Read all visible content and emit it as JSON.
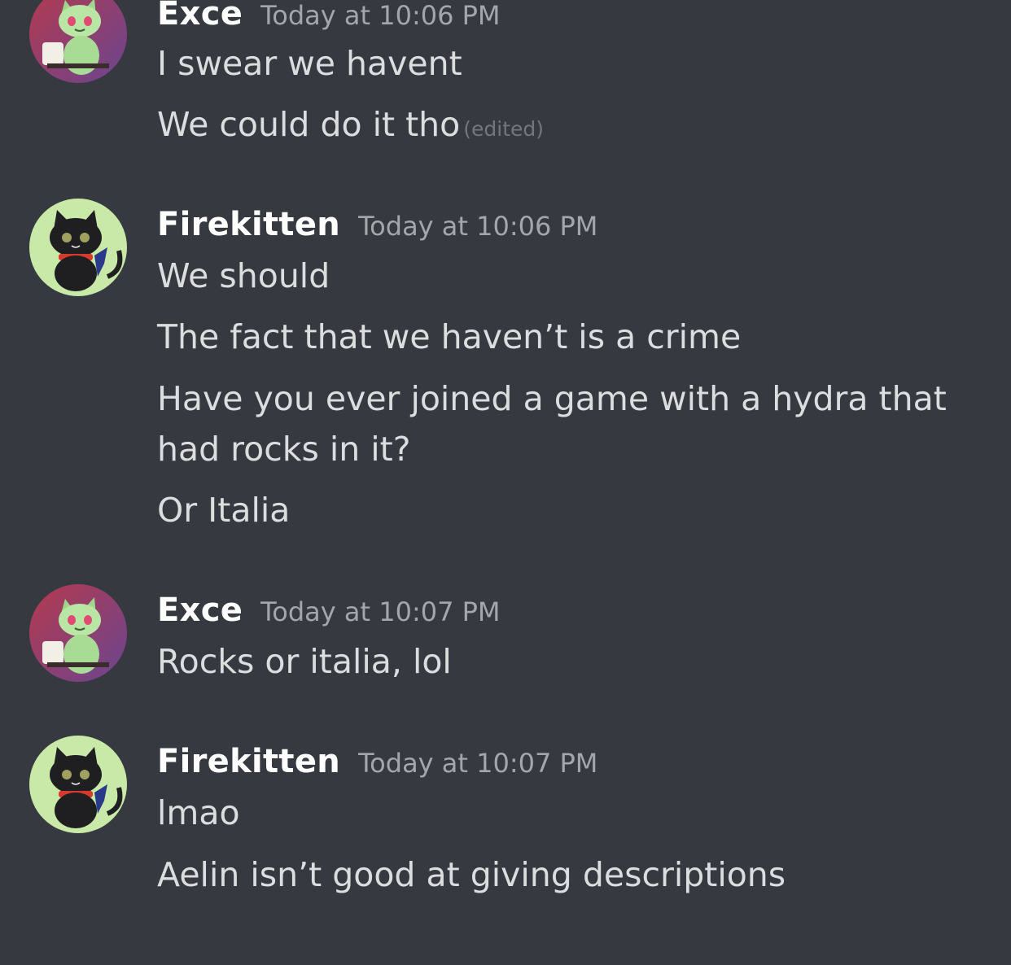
{
  "messages": [
    {
      "author": "Exce",
      "timestamp": "Today at 10:06 PM",
      "avatar_icon": "sprigatito-avatar-icon",
      "lines": [
        "I swear we havent",
        "We could do it tho"
      ],
      "edited_label": "(edited)"
    },
    {
      "author": "Firekitten",
      "timestamp": "Today at 10:06 PM",
      "avatar_icon": "black-cat-avatar-icon",
      "lines": [
        "We should",
        "The fact that we haven’t is a crime",
        "Have you ever joined a game with a hydra that had rocks in it?",
        "Or Italia"
      ]
    },
    {
      "author": "Exce",
      "timestamp": "Today at 10:07 PM",
      "avatar_icon": "sprigatito-avatar-icon",
      "lines": [
        "Rocks or italia, lol"
      ]
    },
    {
      "author": "Firekitten",
      "timestamp": "Today at 10:07 PM",
      "avatar_icon": "black-cat-avatar-icon",
      "lines": [
        "lmao",
        "Aelin isn’t good at giving descriptions"
      ]
    }
  ],
  "colors": {
    "background": "#36393f",
    "username": "#ffffff",
    "timestamp": "#a3a6aa",
    "message_text": "#dcddde",
    "edited_text": "#72767d"
  }
}
